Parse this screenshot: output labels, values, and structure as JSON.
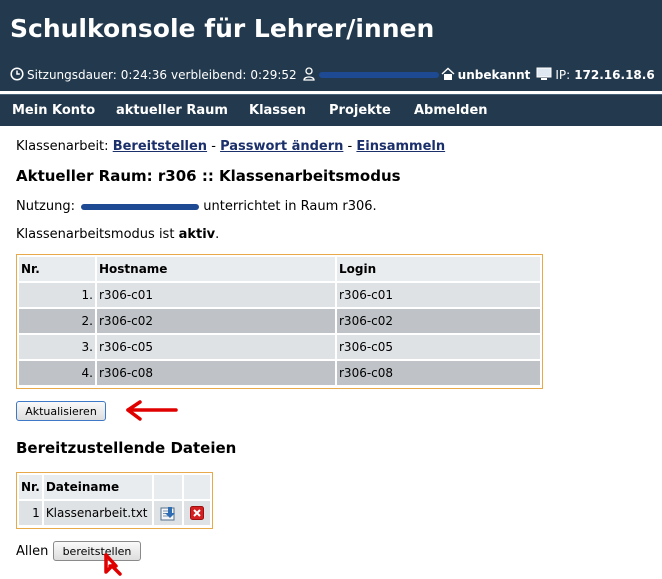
{
  "header": {
    "title": "Schulkonsole für Lehrer/innen",
    "status": {
      "session_label": "Sitzungsdauer:",
      "session_value": "0:24:36",
      "remaining_label": "verbleibend:",
      "remaining_value": "0:29:52",
      "location_value": "unbekannt",
      "ip_label": "IP:",
      "ip_value": "172.16.18.6"
    },
    "icons": {
      "clock": "clock-icon",
      "user": "user-icon",
      "home": "home-icon",
      "monitor": "monitor-icon"
    },
    "colors": {
      "background": "#233a4e",
      "redaction": "#1d4a93"
    }
  },
  "nav": {
    "items": [
      {
        "label": "Mein Konto"
      },
      {
        "label": "aktueller Raum"
      },
      {
        "label": "Klassen"
      },
      {
        "label": "Projekte"
      },
      {
        "label": "Abmelden"
      }
    ]
  },
  "main": {
    "exam_links": {
      "label": "Klassenarbeit:",
      "links": [
        {
          "label": "Bereitstellen"
        },
        {
          "label": "Passwort ändern"
        },
        {
          "label": "Einsammeln"
        }
      ],
      "separator": "-"
    },
    "room_heading": "Aktueller Raum: r306 :: Klassenarbeitsmodus",
    "usage_prefix": "Nutzung:",
    "usage_suffix": "unterrichtet in Raum r306.",
    "mode_text_prefix": "Klassenarbeitsmodus ist",
    "mode_status": "aktiv",
    "mode_text_suffix": ".",
    "hosts_table": {
      "headers": [
        "Nr.",
        "Hostname",
        "Login"
      ],
      "rows": [
        {
          "nr": "1.",
          "hostname": "r306-c01",
          "login": "r306-c01"
        },
        {
          "nr": "2.",
          "hostname": "r306-c02",
          "login": "r306-c02"
        },
        {
          "nr": "3.",
          "hostname": "r306-c05",
          "login": "r306-c05"
        },
        {
          "nr": "4.",
          "hostname": "r306-c08",
          "login": "r306-c08"
        }
      ]
    },
    "refresh_button": "Aktualisieren",
    "files_heading": "Bereitzustellende Dateien",
    "files_table": {
      "headers": [
        "Nr.",
        "Dateiname"
      ],
      "rows": [
        {
          "nr": "1",
          "filename": "Klassenarbeit.txt",
          "action_icon": "upload-icon",
          "delete_icon": "delete-icon"
        }
      ]
    },
    "all_label": "Allen",
    "provide_button": "bereitstellen"
  },
  "annotations": {
    "arrow_color": "#e00000"
  }
}
